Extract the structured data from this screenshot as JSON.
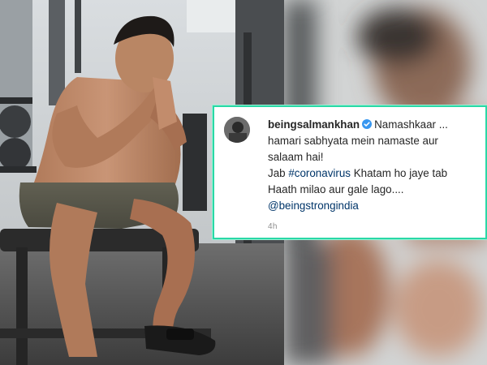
{
  "post": {
    "username": "beingsalmankhan",
    "verified_icon": "verified-badge-icon",
    "caption_line1_rest": "Namashkaar ...",
    "caption_line2": "hamari sabhyata mein namaste aur",
    "caption_line3": "salaam hai!",
    "caption_line4_pre": "Jab ",
    "caption_hashtag": "#coronavirus",
    "caption_line4_post": " Khatam ho jaye tab",
    "caption_line5": "Haath milao aur gale lago....",
    "caption_mention": "@beingstrongindia",
    "timestamp": "4h"
  },
  "colors": {
    "card_border": "#2ad8a6",
    "verified": "#3897f0",
    "link": "#003569"
  }
}
